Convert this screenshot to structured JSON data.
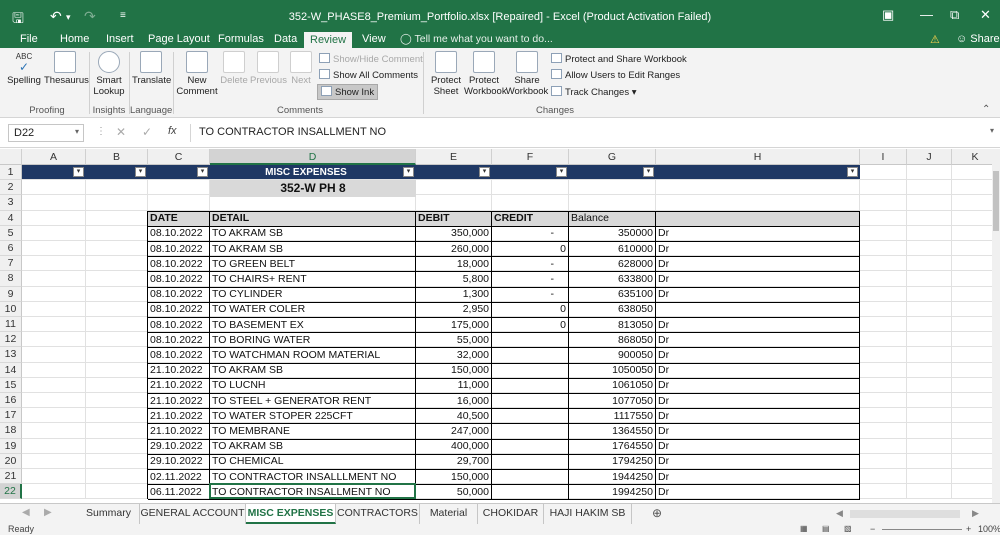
{
  "window": {
    "title": "352-W_PHASE8_Premium_Portfolio.xlsx [Repaired] - Excel (Product Activation Failed)"
  },
  "menu": {
    "tabs": [
      "File",
      "Home",
      "Insert",
      "Page Layout",
      "Formulas",
      "Data",
      "Review",
      "View"
    ],
    "active": "Review",
    "tell_me": "Tell me what you want to do...",
    "share": "Share"
  },
  "ribbon": {
    "proofing": {
      "spelling": "Spelling",
      "thesaurus": "Thesaurus",
      "label": "Proofing"
    },
    "insights": {
      "smart_lookup_1": "Smart",
      "smart_lookup_2": "Lookup",
      "label": "Insights"
    },
    "language": {
      "translate": "Translate",
      "label": "Language"
    },
    "comments": {
      "new_1": "New",
      "new_2": "Comment",
      "delete": "Delete",
      "previous": "Previous",
      "next": "Next",
      "show_hide": "Show/Hide Comment",
      "show_all": "Show All Comments",
      "show_ink": "Show Ink",
      "label": "Comments"
    },
    "changes": {
      "protect_sheet_1": "Protect",
      "protect_sheet_2": "Sheet",
      "protect_wb_1": "Protect",
      "protect_wb_2": "Workbook",
      "share_wb_1": "Share",
      "share_wb_2": "Workbook",
      "protect_share": "Protect and Share Workbook",
      "allow_users": "Allow Users to Edit Ranges",
      "track_changes": "Track Changes",
      "label": "Changes"
    }
  },
  "formula_bar": {
    "name_box": "D22",
    "fx": "fx",
    "content": "TO CONTRACTOR INSALLMENT NO"
  },
  "grid": {
    "columns": [
      "A",
      "B",
      "C",
      "D",
      "E",
      "F",
      "G",
      "H",
      "I",
      "J",
      "K"
    ],
    "rows": [
      "1",
      "2",
      "3",
      "4",
      "5",
      "6",
      "7",
      "8",
      "9",
      "10",
      "11",
      "12",
      "13",
      "14",
      "15",
      "16",
      "17",
      "18",
      "19",
      "20",
      "21",
      "22"
    ],
    "header_row": {
      "d": "MISC EXPENSES"
    },
    "subtitle": "352-W PH 8",
    "table_headers": {
      "date": "DATE",
      "detail": "DETAIL",
      "debit": "DEBIT",
      "credit": "CREDIT",
      "balance": "Balance"
    },
    "records": [
      {
        "date": "08.10.2022",
        "detail": "TO AKRAM SB",
        "debit": "350,000",
        "credit": "-",
        "balance": "350000",
        "dr": "Dr"
      },
      {
        "date": "08.10.2022",
        "detail": "TO AKRAM SB",
        "debit": "260,000",
        "credit": "0",
        "balance": "610000",
        "dr": "Dr"
      },
      {
        "date": "08.10.2022",
        "detail": "TO GREEN BELT",
        "debit": "18,000",
        "credit": "-",
        "balance": "628000",
        "dr": "Dr"
      },
      {
        "date": "08.10.2022",
        "detail": "TO CHAIRS+ RENT",
        "debit": "5,800",
        "credit": "-",
        "balance": "633800",
        "dr": "Dr"
      },
      {
        "date": "08.10.2022",
        "detail": "TO CYLINDER",
        "debit": "1,300",
        "credit": "-",
        "balance": "635100",
        "dr": "Dr"
      },
      {
        "date": "08.10.2022",
        "detail": "TO WATER COLER",
        "debit": "2,950",
        "credit": "0",
        "balance": "638050",
        "dr": ""
      },
      {
        "date": "08.10.2022",
        "detail": "TO BASEMENT EX",
        "debit": "175,000",
        "credit": "0",
        "balance": "813050",
        "dr": "Dr"
      },
      {
        "date": "08.10.2022",
        "detail": "TO BORING WATER",
        "debit": "55,000",
        "credit": "",
        "balance": "868050",
        "dr": "Dr"
      },
      {
        "date": "08.10.2022",
        "detail": "TO WATCHMAN ROOM MATERIAL",
        "debit": "32,000",
        "credit": "",
        "balance": "900050",
        "dr": "Dr"
      },
      {
        "date": "21.10.2022",
        "detail": "TO AKRAM SB",
        "debit": "150,000",
        "credit": "",
        "balance": "1050050",
        "dr": "Dr"
      },
      {
        "date": "21.10.2022",
        "detail": "TO LUCNH",
        "debit": "11,000",
        "credit": "",
        "balance": "1061050",
        "dr": "Dr"
      },
      {
        "date": "21.10.2022",
        "detail": "TO STEEL + GENERATOR RENT",
        "debit": "16,000",
        "credit": "",
        "balance": "1077050",
        "dr": "Dr"
      },
      {
        "date": "21.10.2022",
        "detail": "TO WATER STOPER 225CFT",
        "debit": "40,500",
        "credit": "",
        "balance": "1117550",
        "dr": "Dr"
      },
      {
        "date": "21.10.2022",
        "detail": "TO MEMBRANE",
        "debit": "247,000",
        "credit": "",
        "balance": "1364550",
        "dr": "Dr"
      },
      {
        "date": "29.10.2022",
        "detail": "TO AKRAM SB",
        "debit": "400,000",
        "credit": "",
        "balance": "1764550",
        "dr": "Dr"
      },
      {
        "date": "29.10.2022",
        "detail": "TO CHEMICAL",
        "debit": "29,700",
        "credit": "",
        "balance": "1794250",
        "dr": "Dr"
      },
      {
        "date": "02.11.2022",
        "detail": "TO CONTRACTOR INSALLLMENT NO",
        "debit": "150,000",
        "credit": "",
        "balance": "1944250",
        "dr": "Dr"
      },
      {
        "date": "06.11.2022",
        "detail": "TO CONTRACTOR INSALLMENT NO",
        "debit": "50,000",
        "credit": "",
        "balance": "1994250",
        "dr": "Dr"
      }
    ]
  },
  "sheet_tabs": [
    "Summary",
    "GENERAL ACCOUNT",
    "MISC EXPENSES",
    "CONTRACTORS",
    "Material",
    "CHOKIDAR",
    "HAJI HAKIM SB"
  ],
  "active_sheet": "MISC EXPENSES",
  "status": {
    "left": "Ready",
    "zoom": "100%"
  },
  "colors": {
    "excel_green": "#217346",
    "header_navy": "#1f3864",
    "table_header_gray": "#d9d9d9"
  }
}
